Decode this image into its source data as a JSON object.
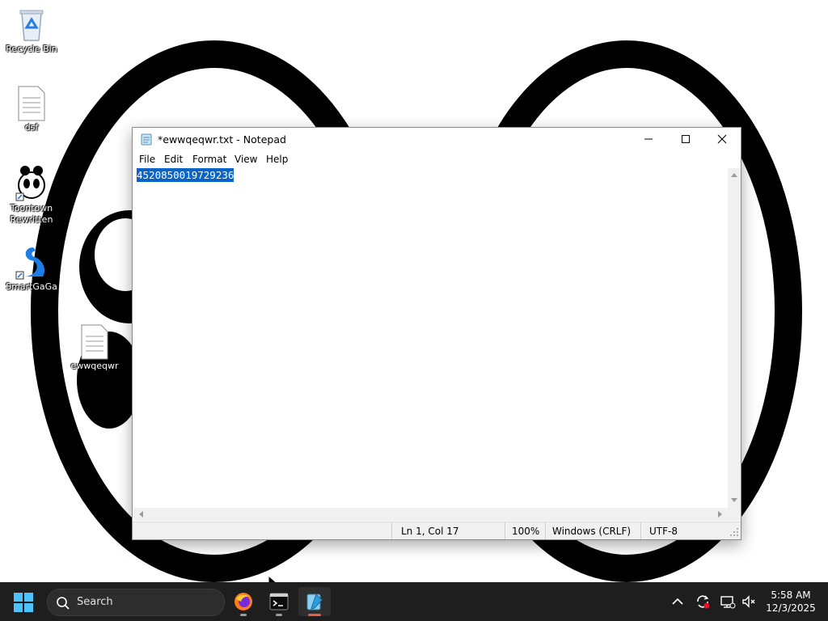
{
  "desktop": {
    "icons": [
      {
        "label": "Recycle Bin",
        "icon": "recycle-bin-icon"
      },
      {
        "label": "dsf",
        "icon": "text-file-icon"
      },
      {
        "label": "Toontown Rewritten",
        "icon": "toontown-icon"
      },
      {
        "label": "SmartGaGa",
        "icon": "smartgaga-icon"
      },
      {
        "label": "ewwqeqwr",
        "icon": "text-file-icon"
      }
    ]
  },
  "notepad": {
    "title": "*ewwqeqwr.txt - Notepad",
    "menu": [
      "File",
      "Edit",
      "Format",
      "View",
      "Help"
    ],
    "content_selected": "4520850019729236",
    "status": {
      "position": "Ln 1, Col 17",
      "zoom": "100%",
      "line_endings": "Windows (CRLF)",
      "encoding": "UTF-8"
    }
  },
  "taskbar": {
    "search_label": "Search",
    "apps": [
      "firefox-icon",
      "terminal-icon",
      "notepad-icon"
    ],
    "clock": {
      "time": "5:58 AM",
      "date": "12/3/2025"
    }
  },
  "colors": {
    "selection": "#0a64c8",
    "taskbar": "#1e1e1e",
    "accent": "#e85d4a"
  }
}
